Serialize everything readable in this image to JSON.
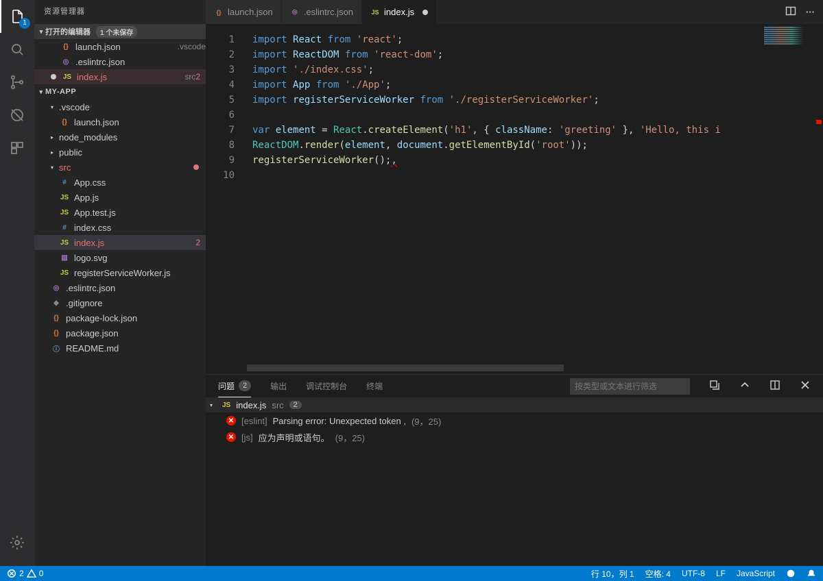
{
  "sidebar_title": "资源管理器",
  "open_editors": {
    "label": "打开的编辑器",
    "badge": "1 个未保存",
    "items": [
      {
        "icon": "{}",
        "icolor": "c-orange",
        "name": "launch.json",
        "meta": ".vscode"
      },
      {
        "icon": "◎",
        "icolor": "c-purple",
        "name": ".eslintrc.json",
        "meta": ""
      },
      {
        "icon": "JS",
        "icolor": "c-yellow",
        "name": "index.js",
        "meta": "src",
        "err": "2",
        "dirty": true,
        "selected": true
      }
    ]
  },
  "project": {
    "name": "MY-APP",
    "tree": [
      {
        "type": "folder",
        "open": true,
        "indent": 1,
        "name": ".vscode"
      },
      {
        "type": "file",
        "indent": 2,
        "icon": "{}",
        "icolor": "c-orange",
        "name": "launch.json"
      },
      {
        "type": "folder",
        "open": false,
        "indent": 1,
        "name": "node_modules"
      },
      {
        "type": "folder",
        "open": false,
        "indent": 1,
        "name": "public"
      },
      {
        "type": "folder",
        "open": true,
        "indent": 1,
        "name": "src",
        "err": true,
        "dot": true
      },
      {
        "type": "file",
        "indent": 2,
        "icon": "#",
        "icolor": "c-blue",
        "name": "App.css"
      },
      {
        "type": "file",
        "indent": 2,
        "icon": "JS",
        "icolor": "c-yellow",
        "name": "App.js"
      },
      {
        "type": "file",
        "indent": 2,
        "icon": "JS",
        "icolor": "c-yellow",
        "name": "App.test.js"
      },
      {
        "type": "file",
        "indent": 2,
        "icon": "#",
        "icolor": "c-blue",
        "name": "index.css"
      },
      {
        "type": "file",
        "indent": 2,
        "icon": "JS",
        "icolor": "c-yellow",
        "name": "index.js",
        "err": "2",
        "selected": true
      },
      {
        "type": "file",
        "indent": 2,
        "icon": "▧",
        "icolor": "c-purple",
        "name": "logo.svg"
      },
      {
        "type": "file",
        "indent": 2,
        "icon": "JS",
        "icolor": "c-yellow",
        "name": "registerServiceWorker.js"
      },
      {
        "type": "file",
        "indent": 1,
        "icon": "◎",
        "icolor": "c-purple",
        "name": ".eslintrc.json"
      },
      {
        "type": "file",
        "indent": 1,
        "icon": "◆",
        "icolor": "c-grey",
        "name": ".gitignore"
      },
      {
        "type": "file",
        "indent": 1,
        "icon": "{}",
        "icolor": "c-orange",
        "name": "package-lock.json"
      },
      {
        "type": "file",
        "indent": 1,
        "icon": "{}",
        "icolor": "c-orange",
        "name": "package.json"
      },
      {
        "type": "file",
        "indent": 1,
        "icon": "ⓘ",
        "icolor": "c-blue",
        "name": "README.md"
      }
    ]
  },
  "tabs": [
    {
      "icon": "{}",
      "icolor": "c-orange",
      "label": "launch.json"
    },
    {
      "icon": "◎",
      "icolor": "c-purple",
      "label": ".eslintrc.json"
    },
    {
      "icon": "JS",
      "icolor": "c-yellow",
      "label": "index.js",
      "active": true,
      "dirty": true
    }
  ],
  "code_lines": [
    [
      {
        "c": "kw",
        "t": "import"
      },
      {
        "c": "pu",
        "t": " "
      },
      {
        "c": "va",
        "t": "React"
      },
      {
        "c": "pu",
        "t": " "
      },
      {
        "c": "kw",
        "t": "from"
      },
      {
        "c": "pu",
        "t": " "
      },
      {
        "c": "st",
        "t": "'react'"
      },
      {
        "c": "pu",
        "t": ";"
      }
    ],
    [
      {
        "c": "kw",
        "t": "import"
      },
      {
        "c": "pu",
        "t": " "
      },
      {
        "c": "va",
        "t": "ReactDOM"
      },
      {
        "c": "pu",
        "t": " "
      },
      {
        "c": "kw",
        "t": "from"
      },
      {
        "c": "pu",
        "t": " "
      },
      {
        "c": "st",
        "t": "'react-dom'"
      },
      {
        "c": "pu",
        "t": ";"
      }
    ],
    [
      {
        "c": "kw",
        "t": "import"
      },
      {
        "c": "pu",
        "t": " "
      },
      {
        "c": "st",
        "t": "'./index.css'"
      },
      {
        "c": "pu",
        "t": ";"
      }
    ],
    [
      {
        "c": "kw",
        "t": "import"
      },
      {
        "c": "pu",
        "t": " "
      },
      {
        "c": "va",
        "t": "App"
      },
      {
        "c": "pu",
        "t": " "
      },
      {
        "c": "kw",
        "t": "from"
      },
      {
        "c": "pu",
        "t": " "
      },
      {
        "c": "st",
        "t": "'./App'"
      },
      {
        "c": "pu",
        "t": ";"
      }
    ],
    [
      {
        "c": "kw",
        "t": "import"
      },
      {
        "c": "pu",
        "t": " "
      },
      {
        "c": "va",
        "t": "registerServiceWorker"
      },
      {
        "c": "pu",
        "t": " "
      },
      {
        "c": "kw",
        "t": "from"
      },
      {
        "c": "pu",
        "t": " "
      },
      {
        "c": "st",
        "t": "'./registerServiceWorker'"
      },
      {
        "c": "pu",
        "t": ";"
      }
    ],
    [],
    [
      {
        "c": "kw",
        "t": "var"
      },
      {
        "c": "pu",
        "t": " "
      },
      {
        "c": "va",
        "t": "element"
      },
      {
        "c": "pu",
        "t": " = "
      },
      {
        "c": "ty",
        "t": "React"
      },
      {
        "c": "pu",
        "t": "."
      },
      {
        "c": "fn",
        "t": "createElement"
      },
      {
        "c": "pu",
        "t": "("
      },
      {
        "c": "st",
        "t": "'h1'"
      },
      {
        "c": "pu",
        "t": ", { "
      },
      {
        "c": "va",
        "t": "className"
      },
      {
        "c": "pu",
        "t": ": "
      },
      {
        "c": "st",
        "t": "'greeting'"
      },
      {
        "c": "pu",
        "t": " }, "
      },
      {
        "c": "st",
        "t": "'Hello, this i"
      }
    ],
    [
      {
        "c": "ty",
        "t": "ReactDOM"
      },
      {
        "c": "pu",
        "t": "."
      },
      {
        "c": "fn",
        "t": "render"
      },
      {
        "c": "pu",
        "t": "("
      },
      {
        "c": "va",
        "t": "element"
      },
      {
        "c": "pu",
        "t": ", "
      },
      {
        "c": "va",
        "t": "document"
      },
      {
        "c": "pu",
        "t": "."
      },
      {
        "c": "fn",
        "t": "getElementById"
      },
      {
        "c": "pu",
        "t": "("
      },
      {
        "c": "st",
        "t": "'root'"
      },
      {
        "c": "pu",
        "t": "));"
      }
    ],
    [
      {
        "c": "fn",
        "t": "registerServiceWorker"
      },
      {
        "c": "pu",
        "t": "();"
      },
      {
        "c": "er",
        "t": ","
      }
    ],
    []
  ],
  "panel": {
    "tabs": [
      {
        "label": "问题",
        "count": "2",
        "active": true
      },
      {
        "label": "输出"
      },
      {
        "label": "调试控制台"
      },
      {
        "label": "终端"
      }
    ],
    "filter_placeholder": "按类型或文本进行筛选",
    "file": {
      "icon": "JS",
      "name": "index.js",
      "dir": "src",
      "count": "2"
    },
    "problems": [
      {
        "source": "[eslint]",
        "msg": "Parsing error: Unexpected token ,",
        "loc": "(9，25)"
      },
      {
        "source": "[js]",
        "msg": "应为声明或语句。",
        "loc": "(9，25)"
      }
    ]
  },
  "status": {
    "errors": "2",
    "warnings": "0",
    "line_col": "行 10，列 1",
    "spaces": "空格: 4",
    "encoding": "UTF-8",
    "eol": "LF",
    "lang": "JavaScript"
  },
  "activity_badge": "1"
}
